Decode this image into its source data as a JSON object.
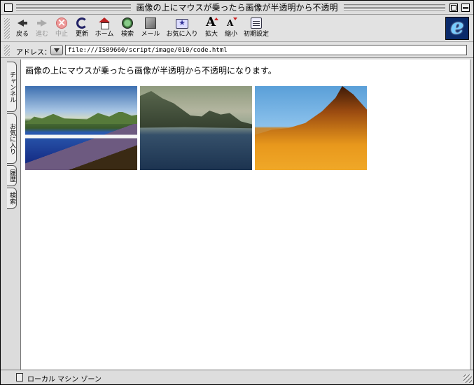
{
  "window": {
    "title": "画像の上にマウスが乗ったら画像が半透明から不透明"
  },
  "toolbar": {
    "buttons": [
      {
        "label": "戻る",
        "icon": "back-arrow-icon",
        "enabled": true
      },
      {
        "label": "進む",
        "icon": "forward-arrow-icon",
        "enabled": false
      },
      {
        "label": "中止",
        "icon": "stop-icon",
        "enabled": false
      },
      {
        "label": "更新",
        "icon": "refresh-icon",
        "enabled": true
      },
      {
        "label": "ホーム",
        "icon": "home-icon",
        "enabled": true
      },
      {
        "label": "検索",
        "icon": "search-icon",
        "enabled": true
      },
      {
        "label": "メール",
        "icon": "mail-icon",
        "enabled": true
      },
      {
        "label": "お気に入り",
        "icon": "favorites-icon",
        "enabled": true
      },
      {
        "label": "拡大",
        "icon": "text-larger-icon",
        "enabled": true
      },
      {
        "label": "縮小",
        "icon": "text-smaller-icon",
        "enabled": true
      },
      {
        "label": "初期設定",
        "icon": "preferences-icon",
        "enabled": true
      }
    ],
    "logo_letter": "e"
  },
  "address": {
    "label": "アドレス：",
    "value": "file:///IS09660/script/image/010/code.html"
  },
  "sidetabs": [
    {
      "label": "チャンネル"
    },
    {
      "label": "お気に入り"
    },
    {
      "label": "履歴"
    },
    {
      "label": "検索"
    }
  ],
  "content": {
    "intro_text": "画像の上にマウスが乗ったら画像が半透明から不透明になります。",
    "images": [
      {
        "name": "coastal-bay-image"
      },
      {
        "name": "mountain-lake-image"
      },
      {
        "name": "desert-peak-image"
      }
    ]
  },
  "status": {
    "zone_text": "ローカル マシン ゾーン"
  }
}
